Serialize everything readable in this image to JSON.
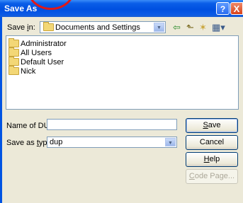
{
  "window": {
    "title": "Save As",
    "help_glyph": "?",
    "close_glyph": "X"
  },
  "save_in": {
    "label_pre": "Save ",
    "label_key": "i",
    "label_post": "n:",
    "value": "Documents and Settings"
  },
  "toolbar": {
    "back": "⇦",
    "up": "⬑",
    "new_folder": "✶",
    "views": "▦▾"
  },
  "files": [
    {
      "name": "Administrator"
    },
    {
      "name": "All Users"
    },
    {
      "name": "Default User"
    },
    {
      "name": "Nick"
    }
  ],
  "name_field": {
    "label": "Name of DUP",
    "value": ""
  },
  "save_type": {
    "label_pre": "Save as ",
    "label_key": "t",
    "label_post": "ype:",
    "value": "dup"
  },
  "buttons": {
    "save_key": "S",
    "save_rest": "ave",
    "cancel": "Cancel",
    "help_key": "H",
    "help_rest": "elp",
    "code_key": "C",
    "code_rest": "ode Page..."
  }
}
